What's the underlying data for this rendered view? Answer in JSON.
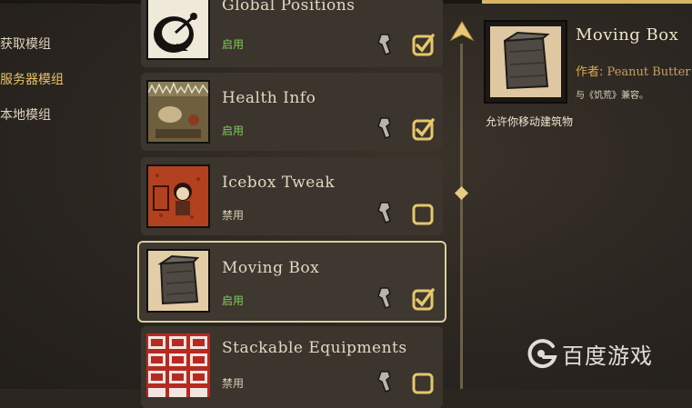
{
  "nav": {
    "items": [
      {
        "label": "获取模组",
        "active": false
      },
      {
        "label": "服务器模组",
        "active": true
      },
      {
        "label": "本地模组",
        "active": false
      }
    ]
  },
  "mods": [
    {
      "name": "Global Positions",
      "status": "启用",
      "enabled": true,
      "selected": false,
      "icon": "satellite-dish-icon"
    },
    {
      "name": "Health Info",
      "status": "启用",
      "enabled": true,
      "selected": false,
      "icon": "health-info-thumbnail"
    },
    {
      "name": "Icebox Tweak",
      "status": "禁用",
      "enabled": false,
      "selected": false,
      "icon": "icebox-tweak-thumbnail"
    },
    {
      "name": "Moving Box",
      "status": "启用",
      "enabled": true,
      "selected": true,
      "icon": "moving-box-thumbnail"
    },
    {
      "name": "Stackable Equipments",
      "status": "禁用",
      "enabled": false,
      "selected": false,
      "icon": "stackable-equipments-thumbnail"
    }
  ],
  "detail": {
    "title": "Moving Box",
    "author_label": "作者:",
    "author_name": "Peanut Butter",
    "compat": "与《饥荒》兼容。",
    "description": "允许你移动建筑物"
  },
  "watermark": {
    "text": "百度游戏"
  },
  "colors": {
    "enabled": "#7fcf57",
    "disabled": "#d9ceb6",
    "accent_gold": "#e8c06a",
    "selected_border": "#d9ce9f"
  }
}
